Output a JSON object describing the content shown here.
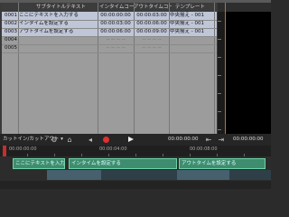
{
  "table": {
    "headers": {
      "col0": "",
      "subtitle": "サブタイトルテキスト",
      "in_tc": "インタイムコード",
      "out_tc": "アウトタイムコード",
      "template": "テンプレート"
    },
    "rows": [
      {
        "num": "0001",
        "text": "ここにテキストを入力する",
        "in": "00:00:00:00",
        "out": "00:00:03:00",
        "tpl": "中央揃え - 001",
        "selected": true
      },
      {
        "num": "0002",
        "text": "インタイムを設定する",
        "in": "00:00:03:00",
        "out": "00:00:06:00",
        "tpl": "中央揃え - 001",
        "selected": true
      },
      {
        "num": "0003",
        "text": "アウトタイムを設定する",
        "in": "00:00:06:00",
        "out": "00:00:09:00",
        "tpl": "中央揃え - 001",
        "selected": true
      },
      {
        "num": "0004",
        "text": "",
        "in": "-- -- -- --",
        "out": "-- -- -- --",
        "tpl": "",
        "selected": false
      },
      {
        "num": "0005",
        "text": "",
        "in": "-- -- -- --",
        "out": "-- -- -- --",
        "tpl": "",
        "selected": false
      }
    ]
  },
  "preview": {
    "header": ""
  },
  "toolbar": {
    "mode_label": "カットイン/カットアウト ▾",
    "timecode_in": "00:00:00:00",
    "timecode_out": "00:00:00:00"
  },
  "timeline": {
    "ruler_labels": [
      "00:00:00:00",
      "00:00:04:00",
      "00:00:08:00"
    ],
    "clips": [
      {
        "label": "ここにテキストを入力する"
      },
      {
        "label": "インタイムを設定する"
      },
      {
        "label": "アウトタイムを設定する"
      }
    ]
  },
  "colors": {
    "clip": "#3f8d6f",
    "selected_row": "#bfc6d8",
    "record": "#e03030",
    "playhead": "#d26a1a"
  }
}
